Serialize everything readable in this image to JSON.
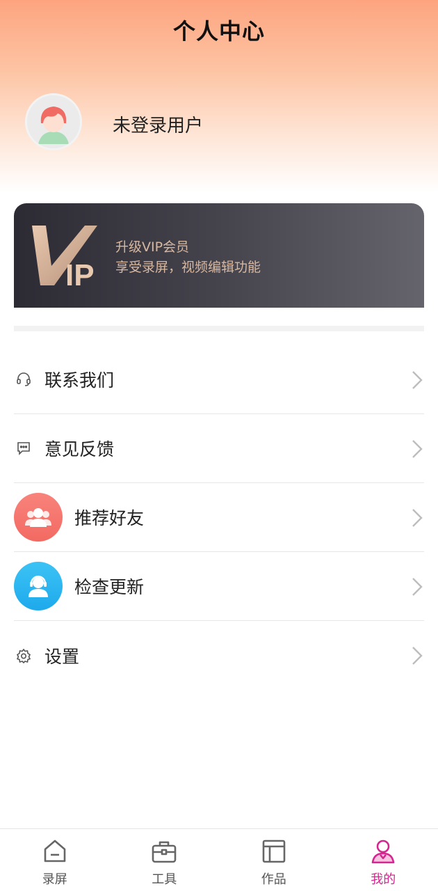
{
  "header": {
    "title": "个人中心"
  },
  "user": {
    "name": "未登录用户",
    "avatar_icon": "user-avatar-icon"
  },
  "vip": {
    "logo_text": "VIP",
    "title": "升级VIP会员",
    "subtitle": "享受录屏，视频编辑功能"
  },
  "menu": [
    {
      "label": "联系我们",
      "icon": "headset-icon"
    },
    {
      "label": "意见反馈",
      "icon": "feedback-icon"
    },
    {
      "label": "推荐好友",
      "icon": "friends-icon",
      "color": "#f7736c"
    },
    {
      "label": "检查更新",
      "icon": "update-icon",
      "color": "#2ab6f2"
    },
    {
      "label": "设置",
      "icon": "gear-icon"
    }
  ],
  "tabbar": [
    {
      "label": "录屏",
      "icon": "home-icon"
    },
    {
      "label": "工具",
      "icon": "briefcase-icon"
    },
    {
      "label": "作品",
      "icon": "layout-icon"
    },
    {
      "label": "我的",
      "icon": "profile-icon",
      "active": true
    }
  ],
  "colors": {
    "accent": "#d4268f",
    "header_top": "#fda47f",
    "vip_text": "#d8b8a0"
  }
}
